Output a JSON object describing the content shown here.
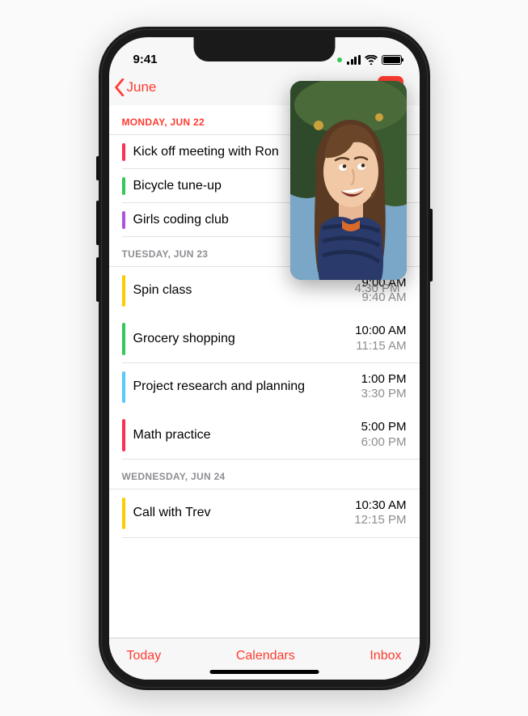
{
  "status": {
    "time": "9:41"
  },
  "nav": {
    "back_label": "June"
  },
  "toolbar": {
    "today": "Today",
    "calendars": "Calendars",
    "inbox": "Inbox"
  },
  "colors": {
    "pink": "#ff2d55",
    "green": "#34c759",
    "purple": "#af52de",
    "yellow": "#ffcc00",
    "blue": "#5ac8fa"
  },
  "pip_obscured_time": "4:30 PM",
  "days": [
    {
      "header": "MONDAY, JUN 22",
      "first": true,
      "events": [
        {
          "title": "Kick off meeting with Ron",
          "color": "pink",
          "start": "",
          "end": ""
        },
        {
          "title": "Bicycle tune-up",
          "color": "green",
          "start": "",
          "end": ""
        },
        {
          "title": "Girls coding club",
          "color": "purple",
          "start": "",
          "end": ""
        }
      ]
    },
    {
      "header": "TUESDAY, JUN 23",
      "events": [
        {
          "title": "Spin class",
          "color": "yellow",
          "start": "9:00 AM",
          "end": "9:40 AM"
        },
        {
          "title": "Grocery shopping",
          "color": "green",
          "start": "10:00 AM",
          "end": "11:15 AM"
        },
        {
          "title": "Project research and planning",
          "color": "blue",
          "start": "1:00 PM",
          "end": "3:30 PM"
        },
        {
          "title": "Math practice",
          "color": "pink",
          "start": "5:00 PM",
          "end": "6:00 PM"
        }
      ]
    },
    {
      "header": "WEDNESDAY, JUN 24",
      "events": [
        {
          "title": "Call with Trev",
          "color": "yellow",
          "start": "10:30 AM",
          "end": "12:15 PM"
        }
      ]
    }
  ]
}
